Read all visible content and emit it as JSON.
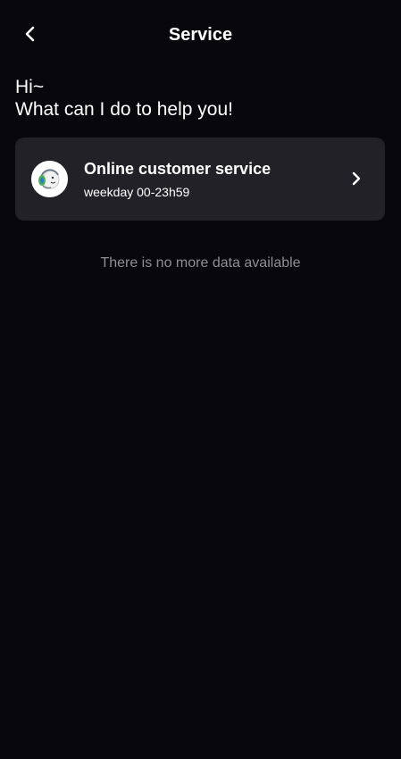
{
  "header": {
    "title": "Service",
    "back_icon": "chevron-left-icon"
  },
  "greeting": {
    "line1": "Hi~",
    "line2": "What can I do to help you!"
  },
  "services": [
    {
      "title": "Online customer service",
      "hours": "weekday 00-23h59",
      "icon": "customer-service-headset-icon",
      "arrow_icon": "chevron-right-icon"
    }
  ],
  "empty_message": "There is no more data available",
  "colors": {
    "background": "#07070c",
    "card": "#222128",
    "muted_text": "#8e8e93",
    "text": "#ffffff",
    "avatar_accent": "#4fae5a"
  }
}
